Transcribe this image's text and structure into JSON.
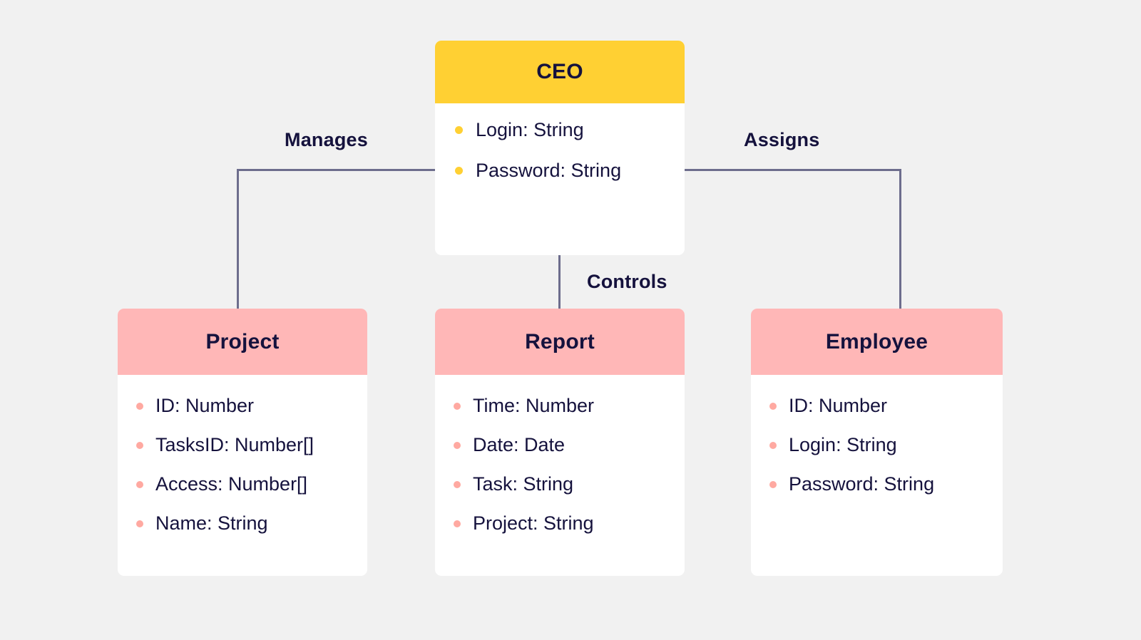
{
  "diagram": {
    "type": "class-diagram",
    "background_color": "#f1f1f1",
    "text_color": "#15123d",
    "connector_color": "#6d6d8d",
    "nodes": [
      {
        "id": "ceo",
        "title": "CEO",
        "header_color": "#ffd033",
        "bullet_color": "#ffd033",
        "attributes": [
          "Login: String",
          "Password: String"
        ]
      },
      {
        "id": "project",
        "title": "Project",
        "header_color": "#ffb7b7",
        "bullet_color": "#ffa9a1",
        "attributes": [
          "ID: Number",
          "TasksID: Number[]",
          "Access: Number[]",
          "Name: String"
        ]
      },
      {
        "id": "report",
        "title": "Report",
        "header_color": "#ffb7b7",
        "bullet_color": "#ffa9a1",
        "attributes": [
          "Time: Number",
          "Date: Date",
          "Task: String",
          "Project: String"
        ]
      },
      {
        "id": "employee",
        "title": "Employee",
        "header_color": "#ffb7b7",
        "bullet_color": "#ffa9a1",
        "attributes": [
          "ID: Number",
          "Login: String",
          "Password: String"
        ]
      }
    ],
    "edges": [
      {
        "id": "manages",
        "label": "Manages",
        "from": "ceo",
        "to": "project"
      },
      {
        "id": "controls",
        "label": "Controls",
        "from": "ceo",
        "to": "report"
      },
      {
        "id": "assigns",
        "label": "Assigns",
        "from": "ceo",
        "to": "employee"
      }
    ]
  }
}
